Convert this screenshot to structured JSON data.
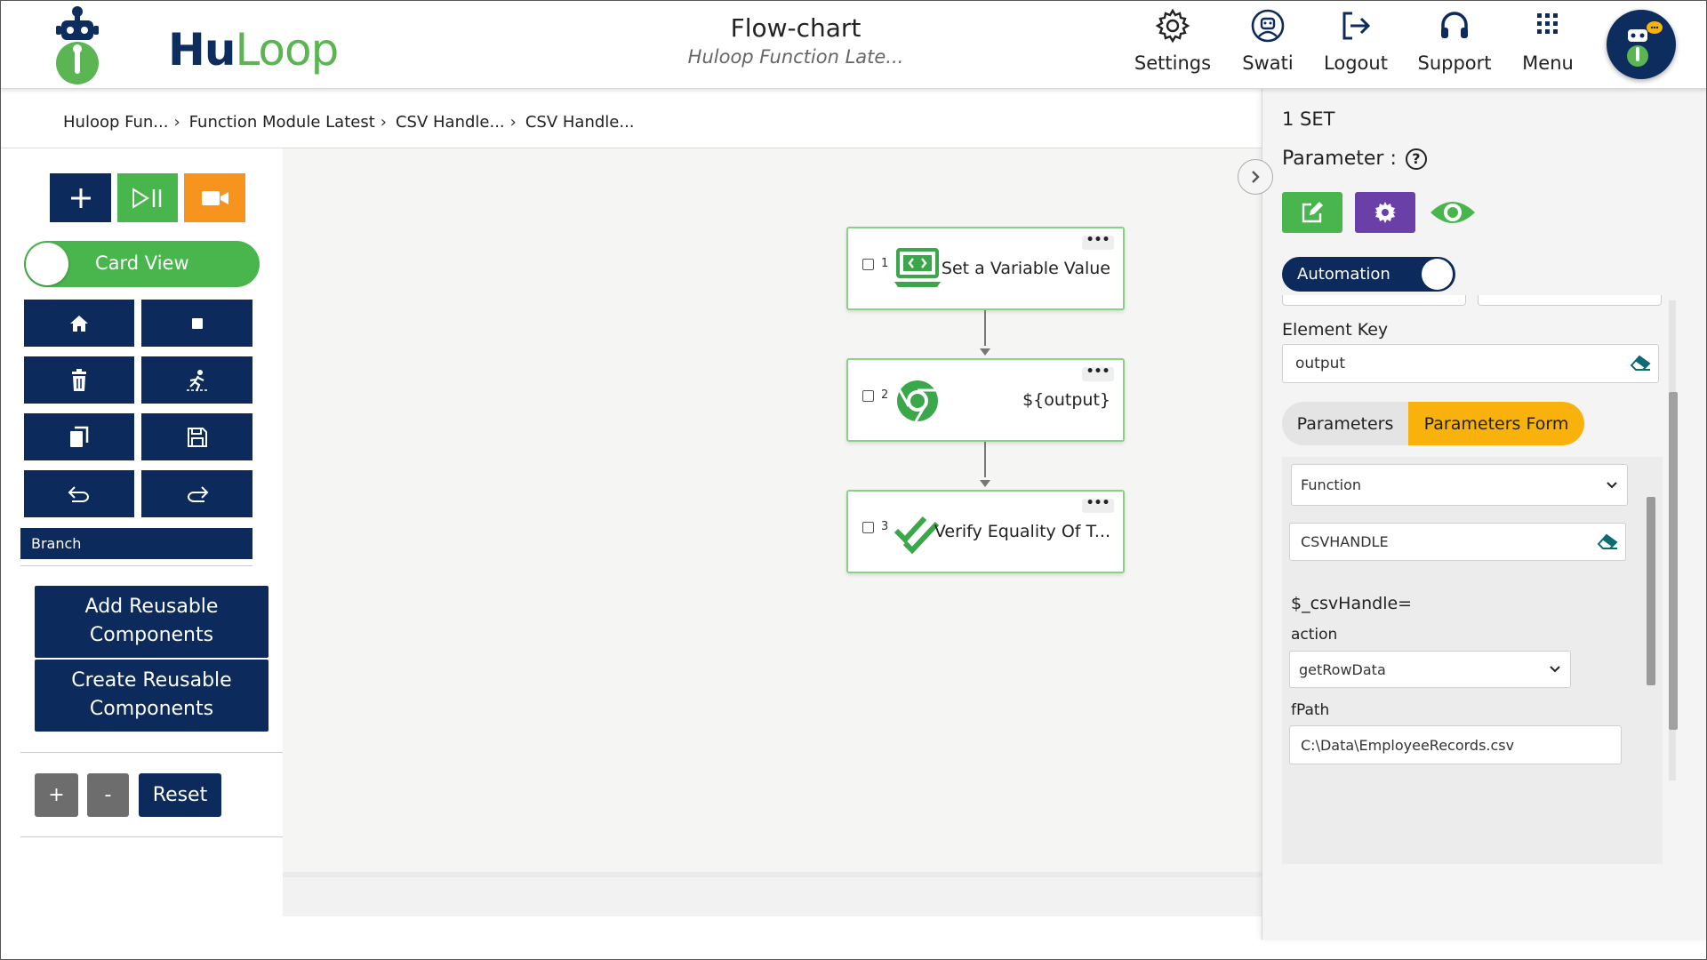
{
  "app": {
    "logo_hu": "Hu",
    "logo_loop": "Loop",
    "title": "Flow-chart",
    "subtitle": "Huloop Function Late..."
  },
  "nav": {
    "settings": "Settings",
    "user": "Swati",
    "logout": "Logout",
    "support": "Support",
    "menu": "Menu"
  },
  "breadcrumb": [
    "Huloop Fun...",
    "Function Module Latest",
    "CSV Handle...",
    "CSV Handle..."
  ],
  "toolbar": {
    "card_view_label": "Card View",
    "branch_label": "Branch",
    "add_reusable": [
      "Add Reusable",
      "Components"
    ],
    "create_reusable": [
      "Create Reusable",
      "Components"
    ],
    "zoom_in": "+",
    "zoom_out": "-",
    "reset": "Reset"
  },
  "flow": {
    "nodes": [
      {
        "num": "1",
        "label": "Set a Variable Value",
        "icon": "monitor-code-icon"
      },
      {
        "num": "2",
        "label": "${output}",
        "icon": "chrome-icon"
      },
      {
        "num": "3",
        "label": "Verify Equality Of T...",
        "icon": "double-check-icon"
      }
    ],
    "more_label": "•••"
  },
  "panel": {
    "title": "1 SET",
    "parameter_label": "Parameter :",
    "help": "?",
    "automation_label": "Automation",
    "element_key_label": "Element Key",
    "element_key_value": "output",
    "tab_parameters": "Parameters",
    "tab_parameters_form": "Parameters Form",
    "function_select": "Function",
    "function_value": "CSVHANDLE",
    "assignment": "$_csvHandle=",
    "action_label": "action",
    "action_value": "getRowData",
    "fpath_label": "fPath",
    "fpath_value": "C:\\Data\\EmployeeRecords.csv"
  },
  "colors": {
    "navy": "#0c2a5c",
    "green": "#49b64d",
    "orange": "#f7941d",
    "purple": "#6a3fa8",
    "yellow": "#f9b20b"
  }
}
